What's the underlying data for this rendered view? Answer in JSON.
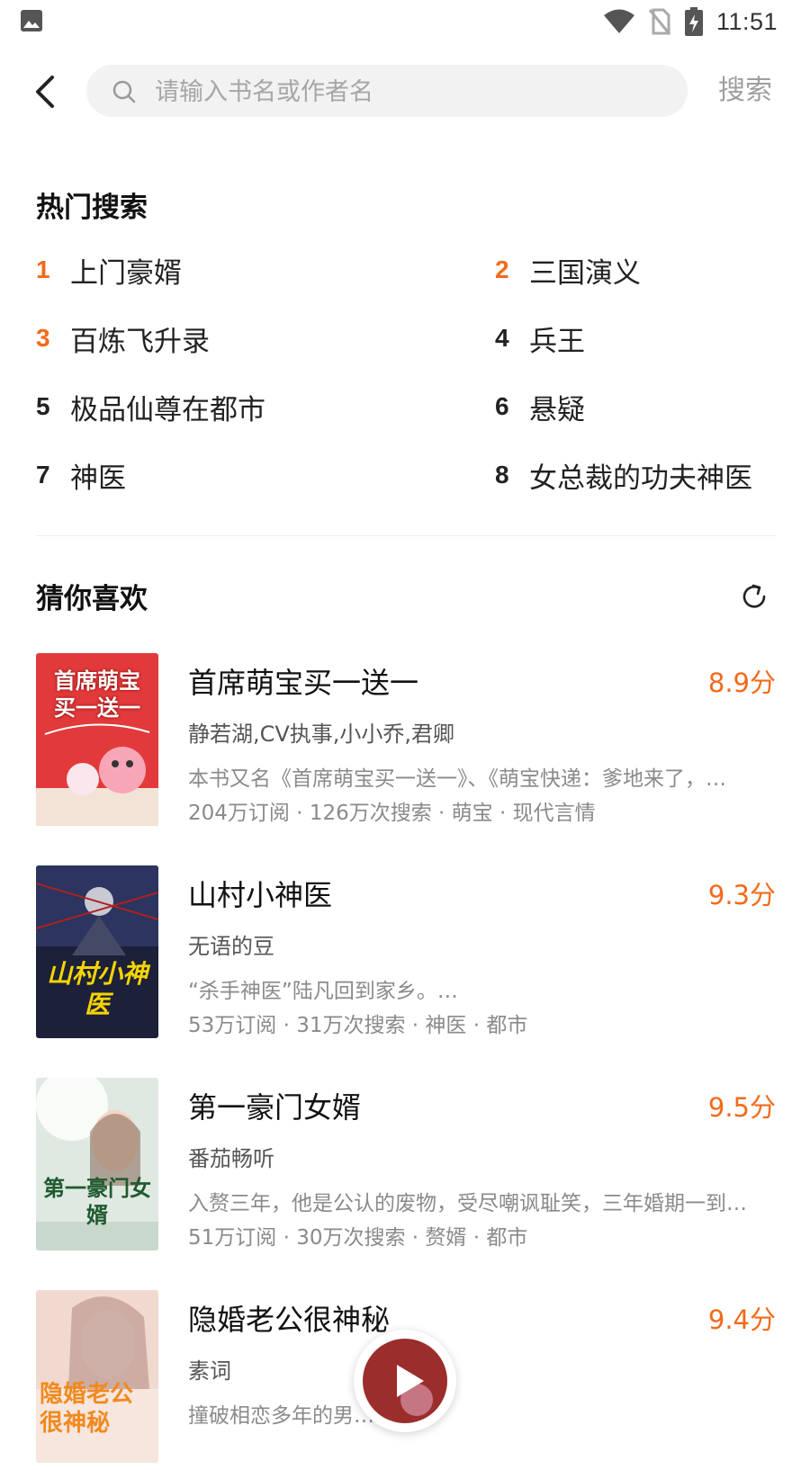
{
  "status_bar": {
    "time": "11:51"
  },
  "search": {
    "placeholder": "请输入书名或作者名",
    "value": "",
    "button_label": "搜索"
  },
  "hot_search": {
    "title": "热门搜索",
    "items": [
      {
        "rank": "1",
        "label": "上门豪婿"
      },
      {
        "rank": "2",
        "label": "三国演义"
      },
      {
        "rank": "3",
        "label": "百炼飞升录"
      },
      {
        "rank": "4",
        "label": "兵王"
      },
      {
        "rank": "5",
        "label": "极品仙尊在都市"
      },
      {
        "rank": "6",
        "label": "悬疑"
      },
      {
        "rank": "7",
        "label": "神医"
      },
      {
        "rank": "8",
        "label": "女总裁的功夫神医"
      }
    ]
  },
  "guess": {
    "title": "猜你喜欢",
    "books": [
      {
        "title": "首席萌宝买一送一",
        "score": "8.9分",
        "author": "静若湖,CV执事,小小乔,君卿",
        "desc": "本书又名《首席萌宝买一送一》、《萌宝快递：爹地来了，…",
        "meta": "204万订阅 · 126万次搜索 · 萌宝 · 现代言情",
        "cover": {
          "title": "首席萌宝买一送一",
          "bg": "#e23a3a"
        }
      },
      {
        "title": "山村小神医",
        "score": "9.3分",
        "author": "无语的豆",
        "desc": "“杀手神医”陆凡回到家乡。…",
        "meta": "53万订阅 · 31万次搜索 · 神医 · 都市",
        "cover": {
          "title": "山村小神医",
          "bg": "#1c2038"
        }
      },
      {
        "title": "第一豪门女婿",
        "score": "9.5分",
        "author": "番茄畅听",
        "desc": "入赘三年，他是公认的废物，受尽嘲讽耻笑，三年婚期一到…",
        "meta": "51万订阅 · 30万次搜索 · 赘婿 · 都市",
        "cover": {
          "title": "第一豪门女婿",
          "bg": "#dfe9e2"
        }
      },
      {
        "title": "隐婚老公很神秘",
        "score": "9.4分",
        "author": "素词",
        "desc": "撞破相恋多年的男…",
        "meta": "",
        "cover": {
          "title": "隐婚老公很神秘",
          "bg": "#f2d9cf"
        }
      }
    ]
  },
  "colors": {
    "accent": "#f36a1a",
    "text": "#222222",
    "muted": "#8a8a8a",
    "search_bg": "#f2f2f2"
  },
  "icons": [
    "image-icon",
    "wifi-icon",
    "no-sim-icon",
    "battery-charging-icon",
    "back-arrow-icon",
    "search-icon",
    "refresh-icon",
    "play-icon"
  ]
}
